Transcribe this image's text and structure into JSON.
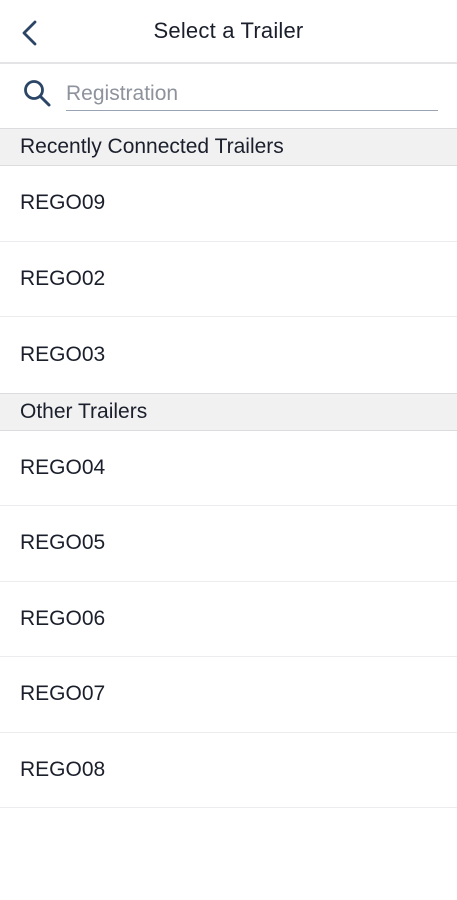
{
  "header": {
    "title": "Select a Trailer"
  },
  "search": {
    "placeholder": "Registration",
    "value": ""
  },
  "sections": {
    "recent": {
      "title": "Recently Connected Trailers",
      "items": [
        "REGO09",
        "REGO02",
        "REGO03"
      ]
    },
    "other": {
      "title": "Other Trailers",
      "items": [
        "REGO04",
        "REGO05",
        "REGO06",
        "REGO07",
        "REGO08"
      ]
    }
  },
  "icons": {
    "back": "chevron-left-icon",
    "search": "search-icon"
  },
  "colors": {
    "accent": "#2b4566",
    "section_background": "#f1f1f2",
    "text": "#1a1f2b"
  }
}
